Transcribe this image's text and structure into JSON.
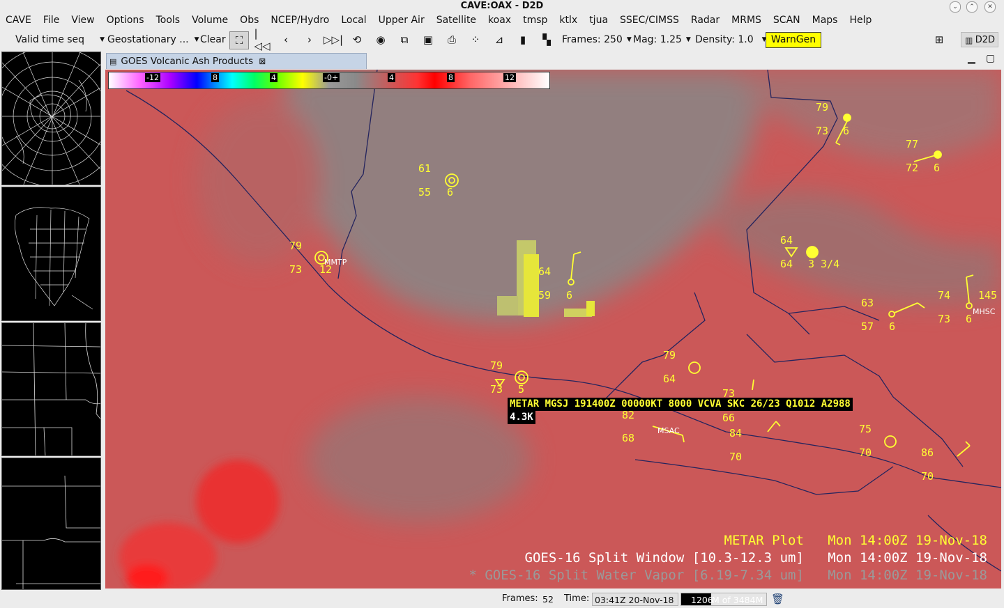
{
  "window": {
    "title": "CAVE:OAX - D2D"
  },
  "menubar": {
    "items": [
      "CAVE",
      "File",
      "View",
      "Options",
      "Tools",
      "Volume",
      "Obs",
      "NCEP/Hydro",
      "Local",
      "Upper Air",
      "Satellite",
      "koax",
      "tmsp",
      "ktlx",
      "tjua",
      "SSEC/CIMSS",
      "Radar",
      "MRMS",
      "SCAN",
      "Maps",
      "Help"
    ]
  },
  "toolbar": {
    "valid_time": "Valid time seq",
    "projection": "Geostationary ...",
    "clear": "Clear",
    "frames": "Frames: 250",
    "mag": "Mag: 1.25",
    "density": "Density: 1.0",
    "warngen": "WarnGen",
    "perspective": "D2D",
    "accent": "#ffff00"
  },
  "tab": {
    "label": "GOES Volcanic Ash Products"
  },
  "colorbar": {
    "labels": [
      "-12",
      "8",
      "4",
      "-0+",
      "4",
      "8",
      "12"
    ]
  },
  "map": {
    "background": "#c85555",
    "obs_color": "#ffff33",
    "stations": [
      {
        "temp": "79",
        "dew": "73",
        "extra": "6"
      },
      {
        "temp": "77",
        "dew": "72",
        "extra": "6"
      },
      {
        "temp": "61",
        "dew": "55",
        "extra": "6"
      },
      {
        "temp": "79",
        "dew": "73",
        "extra": "12",
        "id": "MMTP"
      },
      {
        "temp": "64",
        "dew": "64",
        "extra": "3 3/4"
      },
      {
        "temp": "64",
        "dew": "59",
        "extra": "6"
      },
      {
        "temp": "74",
        "dew": "73",
        "extra": "6",
        "wind": "145",
        "id": "MHSC"
      },
      {
        "temp": "63",
        "dew": "57",
        "extra": "6"
      },
      {
        "temp": "79",
        "dew": "64"
      },
      {
        "temp": "79",
        "dew": "73",
        "extra": "5"
      },
      {
        "temp": "73",
        "dew": "66"
      },
      {
        "temp": "82",
        "dew": "68",
        "id": "MSAC"
      },
      {
        "temp": "84",
        "dew": "70"
      },
      {
        "temp": "75",
        "dew": "70"
      },
      {
        "temp": "86",
        "dew": "70"
      }
    ],
    "sample_readout": {
      "line1": "METAR MGSJ 191400Z 00000KT 8000 VCVA SKC 26/23 Q1012 A2988",
      "line2": "4.3K"
    },
    "legend": [
      {
        "name": "METAR Plot",
        "time": "Mon 14:00Z 19-Nov-18",
        "color": "#ffff33"
      },
      {
        "name": "GOES-16 Split Window [10.3-12.3 um]",
        "time": "Mon 14:00Z 19-Nov-18",
        "color": "#ffffff"
      },
      {
        "name": "* GOES-16 Split Water Vapor [6.19-7.34 um]",
        "time": "Mon 14:00Z 19-Nov-18",
        "color": "#9a9a9a"
      }
    ]
  },
  "status": {
    "frames_label": "Frames:",
    "frames_value": "52",
    "time_label": "Time:",
    "time_value": "03:41Z 20-Nov-18",
    "memory_used": "1206",
    "memory_total": "M of 3484M"
  }
}
